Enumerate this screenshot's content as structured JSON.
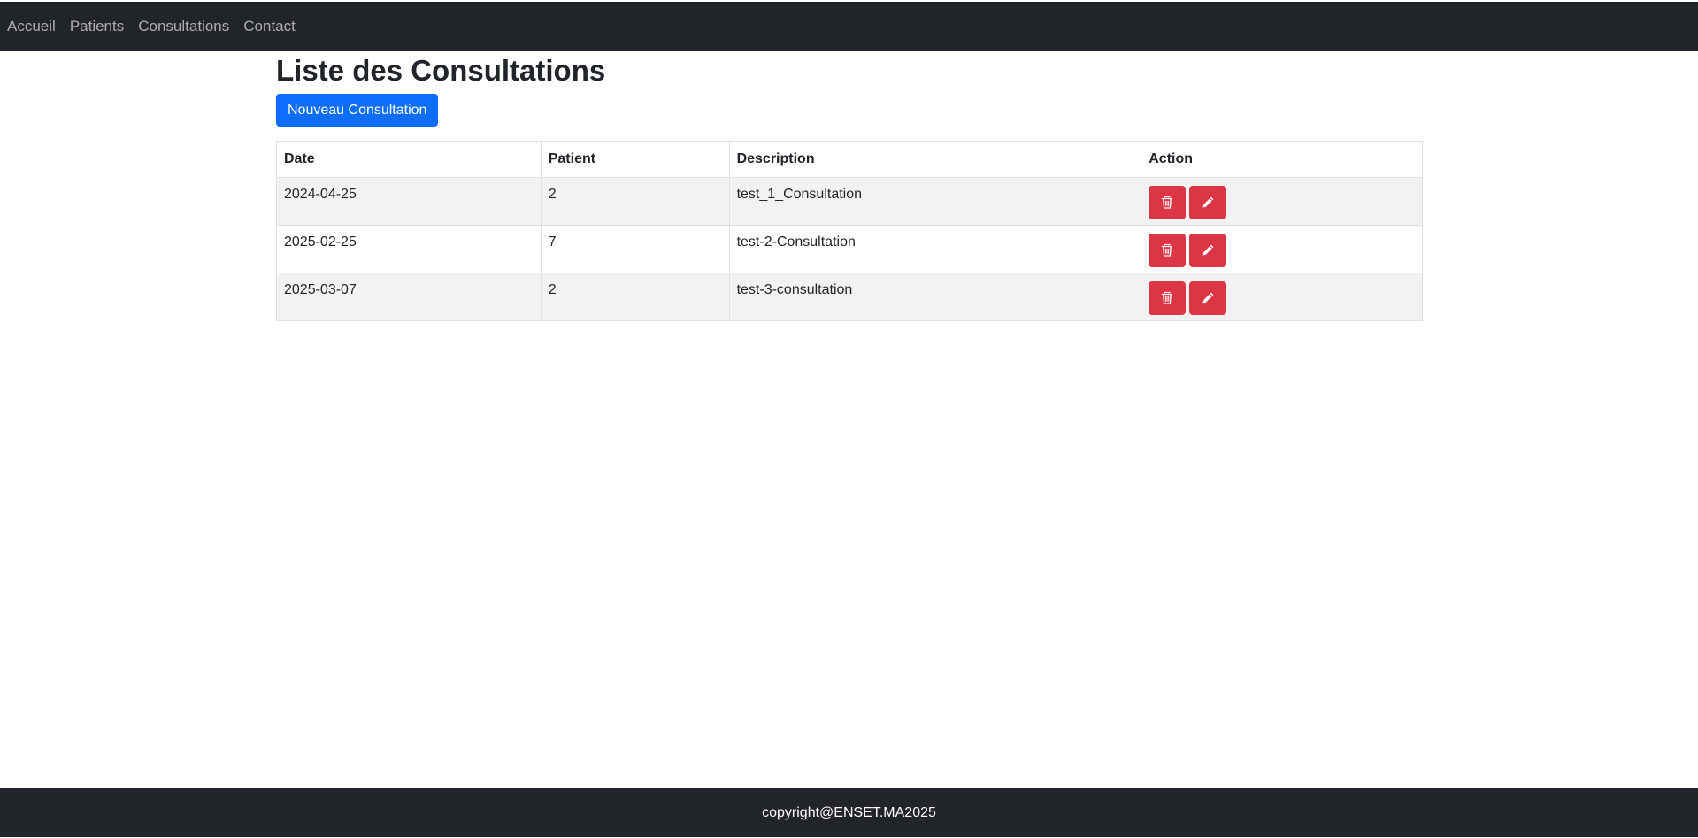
{
  "nav": {
    "items": [
      {
        "label": "Accueil"
      },
      {
        "label": "Patients"
      },
      {
        "label": "Consultations"
      },
      {
        "label": "Contact"
      }
    ]
  },
  "main": {
    "title": "Liste des Consultations",
    "new_button_label": "Nouveau Consultation",
    "table": {
      "headers": [
        "Date",
        "Patient",
        "Description",
        "Action"
      ],
      "rows": [
        {
          "date": "2024-04-25",
          "patient": "2",
          "description": "test_1_Consultation"
        },
        {
          "date": "2025-02-25",
          "patient": "7",
          "description": "test-2-Consultation"
        },
        {
          "date": "2025-03-07",
          "patient": "2",
          "description": "test-3-consultation"
        }
      ],
      "row_actions": [
        "trash-icon",
        "pencil-icon"
      ]
    }
  },
  "footer": {
    "text": "copyright@ENSET.MA2025"
  },
  "colors": {
    "navbar_bg": "#212529",
    "primary": "#0d6efd",
    "danger": "#dc3545",
    "stripe": "#f2f2f2"
  }
}
